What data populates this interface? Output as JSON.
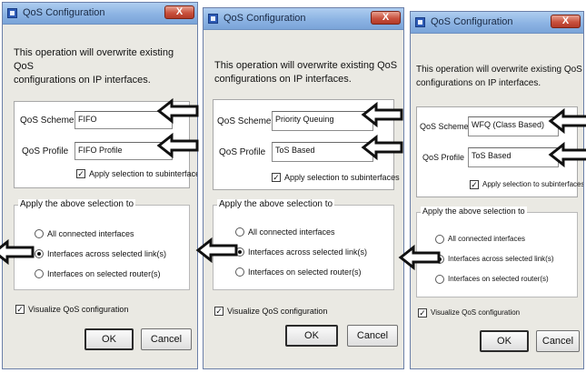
{
  "dialogs": [
    {
      "title": "QoS Configuration",
      "close": "X",
      "description": "This operation will overwrite existing QoS\nconfigurations on IP interfaces.",
      "scheme_label": "QoS Scheme",
      "scheme_value": "FIFO",
      "profile_label": "QoS Profile",
      "profile_value": "FIFO Profile",
      "apply_sub_label": "Apply selection to subinterfaces",
      "apply_sub_checked": true,
      "group_title": "Apply the above selection to",
      "radio_options": [
        "All connected interfaces",
        "Interfaces across selected link(s)",
        "Interfaces on selected router(s)"
      ],
      "radio_selected": 1,
      "visualize_label": "Visualize QoS configuration",
      "visualize_checked": true,
      "ok": "OK",
      "cancel": "Cancel"
    },
    {
      "title": "QoS Configuration",
      "close": "X",
      "description": "This operation will overwrite existing QoS\nconfigurations on IP interfaces.",
      "scheme_label": "QoS Scheme",
      "scheme_value": "Priority Queuing",
      "profile_label": "QoS Profile",
      "profile_value": "ToS Based",
      "apply_sub_label": "Apply selection to subinterfaces",
      "apply_sub_checked": true,
      "group_title": "Apply the above selection to",
      "radio_options": [
        "All connected interfaces",
        "Interfaces across selected link(s)",
        "Interfaces on selected router(s)"
      ],
      "radio_selected": 1,
      "visualize_label": "Visualize QoS configuration",
      "visualize_checked": true,
      "ok": "OK",
      "cancel": "Cancel"
    },
    {
      "title": "QoS Configuration",
      "close": "X",
      "description": "This operation will overwrite existing QoS\nconfigurations on IP interfaces.",
      "scheme_label": "QoS Scheme",
      "scheme_value": "WFQ (Class Based)",
      "profile_label": "QoS Profile",
      "profile_value": "ToS Based",
      "apply_sub_label": "Apply selection to subinterfaces",
      "apply_sub_checked": true,
      "group_title": "Apply the above selection to",
      "radio_options": [
        "All connected interfaces",
        "Interfaces across selected link(s)",
        "Interfaces on selected router(s)"
      ],
      "radio_selected": 1,
      "visualize_label": "Visualize QoS configuration",
      "visualize_checked": true,
      "ok": "OK",
      "cancel": "Cancel"
    }
  ],
  "icons": {
    "title_icon": "app-window-icon",
    "annotation_arrow": "left-arrow-icon"
  },
  "colors": {
    "titlebar": "#8cb3e3",
    "dialog_bg": "#eae9e3",
    "close_button": "#c9523e",
    "arrow": "#111111"
  }
}
